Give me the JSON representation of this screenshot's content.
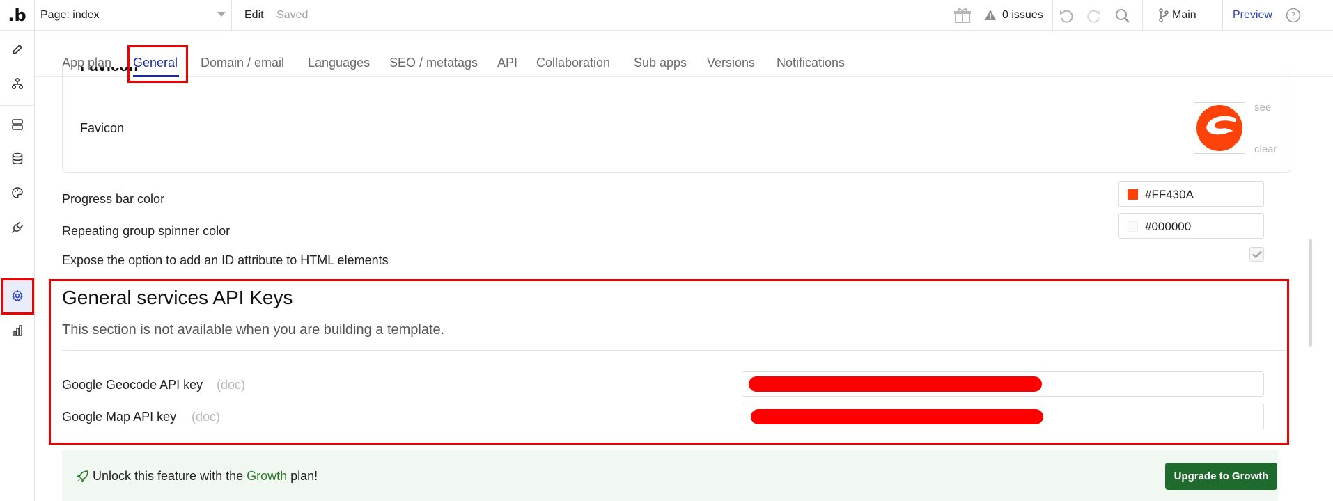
{
  "topbar": {
    "logo": ".b",
    "page_select": "Page: index",
    "mode_edit": "Edit",
    "mode_saved": "Saved",
    "issues": "0 issues",
    "branch": "Main",
    "preview": "Preview"
  },
  "tabs": [
    {
      "label": "App plan"
    },
    {
      "label": "General",
      "active": true
    },
    {
      "label": "Domain / email"
    },
    {
      "label": "Languages"
    },
    {
      "label": "SEO / metatags"
    },
    {
      "label": "API"
    },
    {
      "label": "Collaboration"
    },
    {
      "label": "Sub apps"
    },
    {
      "label": "Versions"
    },
    {
      "label": "Notifications"
    }
  ],
  "favicon": {
    "section_title": "Favicon",
    "label": "Favicon",
    "see": "see",
    "clear": "clear"
  },
  "settings": {
    "progress_bar_label": "Progress bar color",
    "progress_bar_value": "#FF430A",
    "spinner_label": "Repeating group spinner color",
    "spinner_value": "#000000",
    "expose_id_label": "Expose the option to add an ID attribute to HTML elements",
    "expose_id_checked": true
  },
  "api_keys": {
    "title": "General services API Keys",
    "subtitle": "This section is not available when you are building a template.",
    "geocode_label": "Google Geocode API key",
    "geocode_doc": "(doc)",
    "map_label": "Google Map API key",
    "map_doc": "(doc)"
  },
  "growth": {
    "text_before": "Unlock this feature with the ",
    "plan": "Growth",
    "text_after": " plan!",
    "button": "Upgrade to Growth"
  },
  "colors": {
    "accent": "#1b2a9c",
    "highlight": "#f20000",
    "progress_swatch": "#FF430A",
    "upgrade_button": "#1f6b2e"
  }
}
